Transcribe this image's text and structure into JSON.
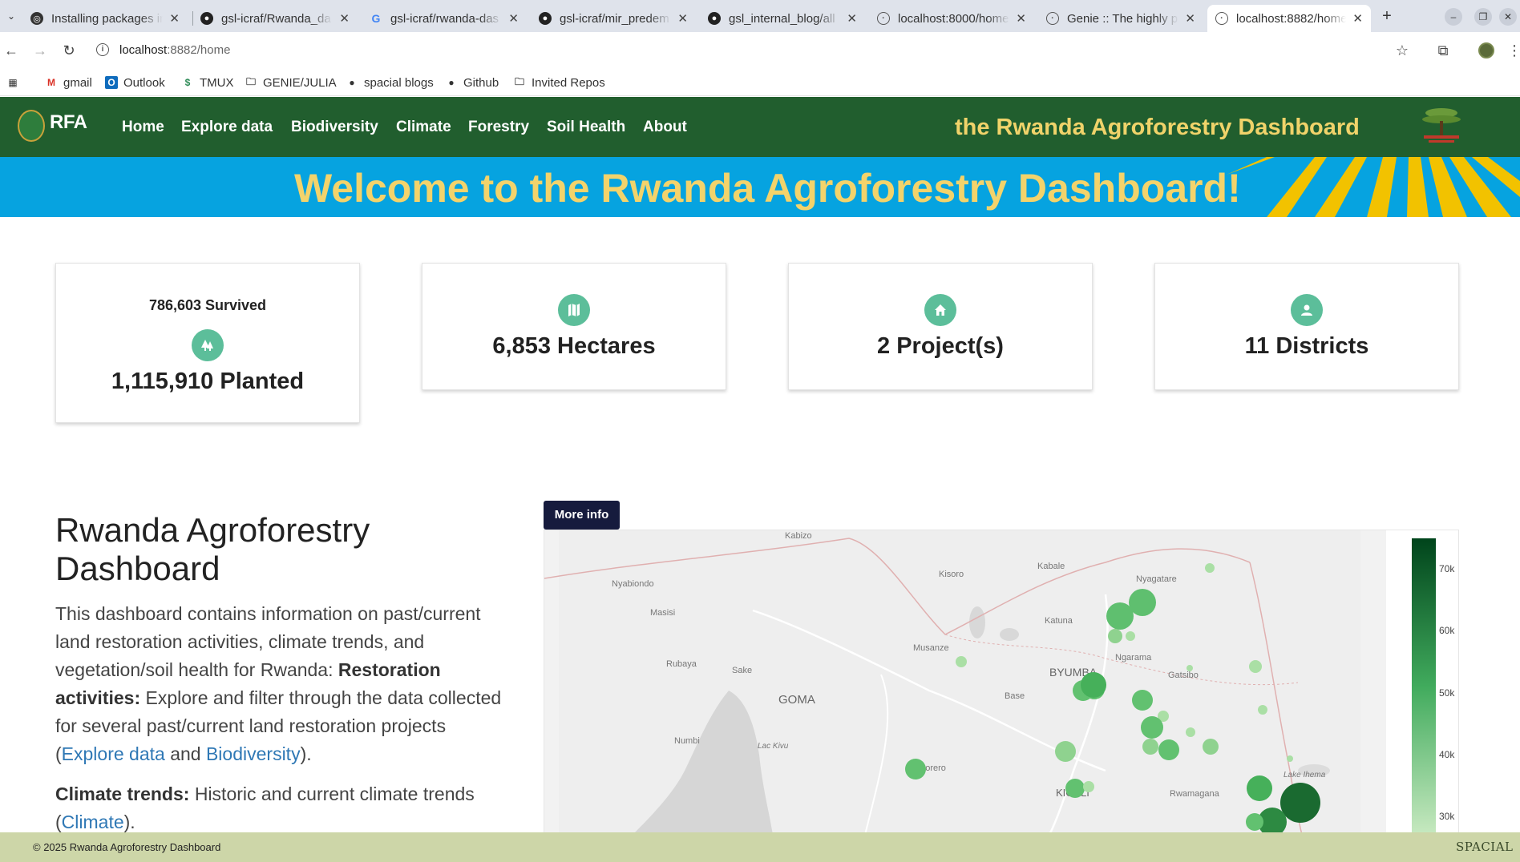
{
  "browser": {
    "tabs": [
      {
        "title": "Installing packages in",
        "favicon": "circle-icon"
      },
      {
        "title": "gsl-icraf/Rwanda_da",
        "favicon": "github-icon"
      },
      {
        "title": "gsl-icraf/rwanda-das",
        "favicon": "google-icon"
      },
      {
        "title": "gsl-icraf/mir_predem",
        "favicon": "github-icon"
      },
      {
        "title": "gsl_internal_blog/all",
        "favicon": "github-icon"
      },
      {
        "title": "localhost:8000/home",
        "favicon": "globe-icon"
      },
      {
        "title": "Genie :: The highly p",
        "favicon": "globe-icon"
      },
      {
        "title": "localhost:8882/home",
        "favicon": "globe-icon",
        "active": true
      }
    ],
    "url_host": "localhost",
    "url_rest": ":8882/home",
    "bookmarks": [
      "gmail",
      "Outlook",
      "TMUX",
      "GENIE/JULIA",
      "spacial blogs",
      "Github",
      "Invited Repos"
    ]
  },
  "nav": {
    "logo_text": "RFA",
    "links": [
      "Home",
      "Explore data",
      "Biodiversity",
      "Climate",
      "Forestry",
      "Soil Health",
      "About"
    ],
    "title": "the Rwanda Agroforestry Dashboard"
  },
  "banner": {
    "text": "Welcome to the Rwanda Agroforestry Dashboard!"
  },
  "stats": {
    "survived": "786,603 Survived",
    "planted": "1,115,910 Planted",
    "hectares": "6,853 Hectares",
    "projects": "2 Project(s)",
    "districts": "11 Districts"
  },
  "content": {
    "heading": "Rwanda Agroforestry Dashboard",
    "intro": "This dashboard contains information on past/current land restoration activities, climate trends, and vegetation/soil health for Rwanda:",
    "restoration_label": "Restoration activities:",
    "restoration_text": " Explore and filter through the data collected for several past/current land restoration projects (",
    "explore_link": "Explore data",
    "and_text": " and ",
    "biodiversity_link": "Biodiversity",
    "close_paren": ").",
    "climate_label": "Climate trends:",
    "climate_text": " Historic and current climate trends (",
    "climate_link": "Climate",
    "climate_close": ")."
  },
  "map": {
    "more_info": "More info",
    "places": [
      "Kabizo",
      "Kisoro",
      "Kabale",
      "Nyagatare",
      "Nyabiondo",
      "Masisi",
      "Katuna",
      "Musanze",
      "Rubaya",
      "Sake",
      "BYUMBA",
      "Ngarama",
      "Gatsibo",
      "GOMA",
      "Base",
      "Numbi",
      "Lac Kivu",
      "Nyarorero",
      "KIGALI",
      "Rwamagana",
      "Lake Ihema"
    ],
    "colorbar_ticks": [
      "70k",
      "60k",
      "50k",
      "40k",
      "30k"
    ]
  },
  "footer": {
    "copyright": "© 2025 Rwanda Agroforestry Dashboard",
    "brand": "SPACIAL"
  },
  "colors": {
    "nav_green": "#215e2e",
    "banner_blue": "#06a3e0",
    "title_yellow": "#f0d36a",
    "icon_teal": "#5cbe9a",
    "footer": "#cdd6a8"
  }
}
